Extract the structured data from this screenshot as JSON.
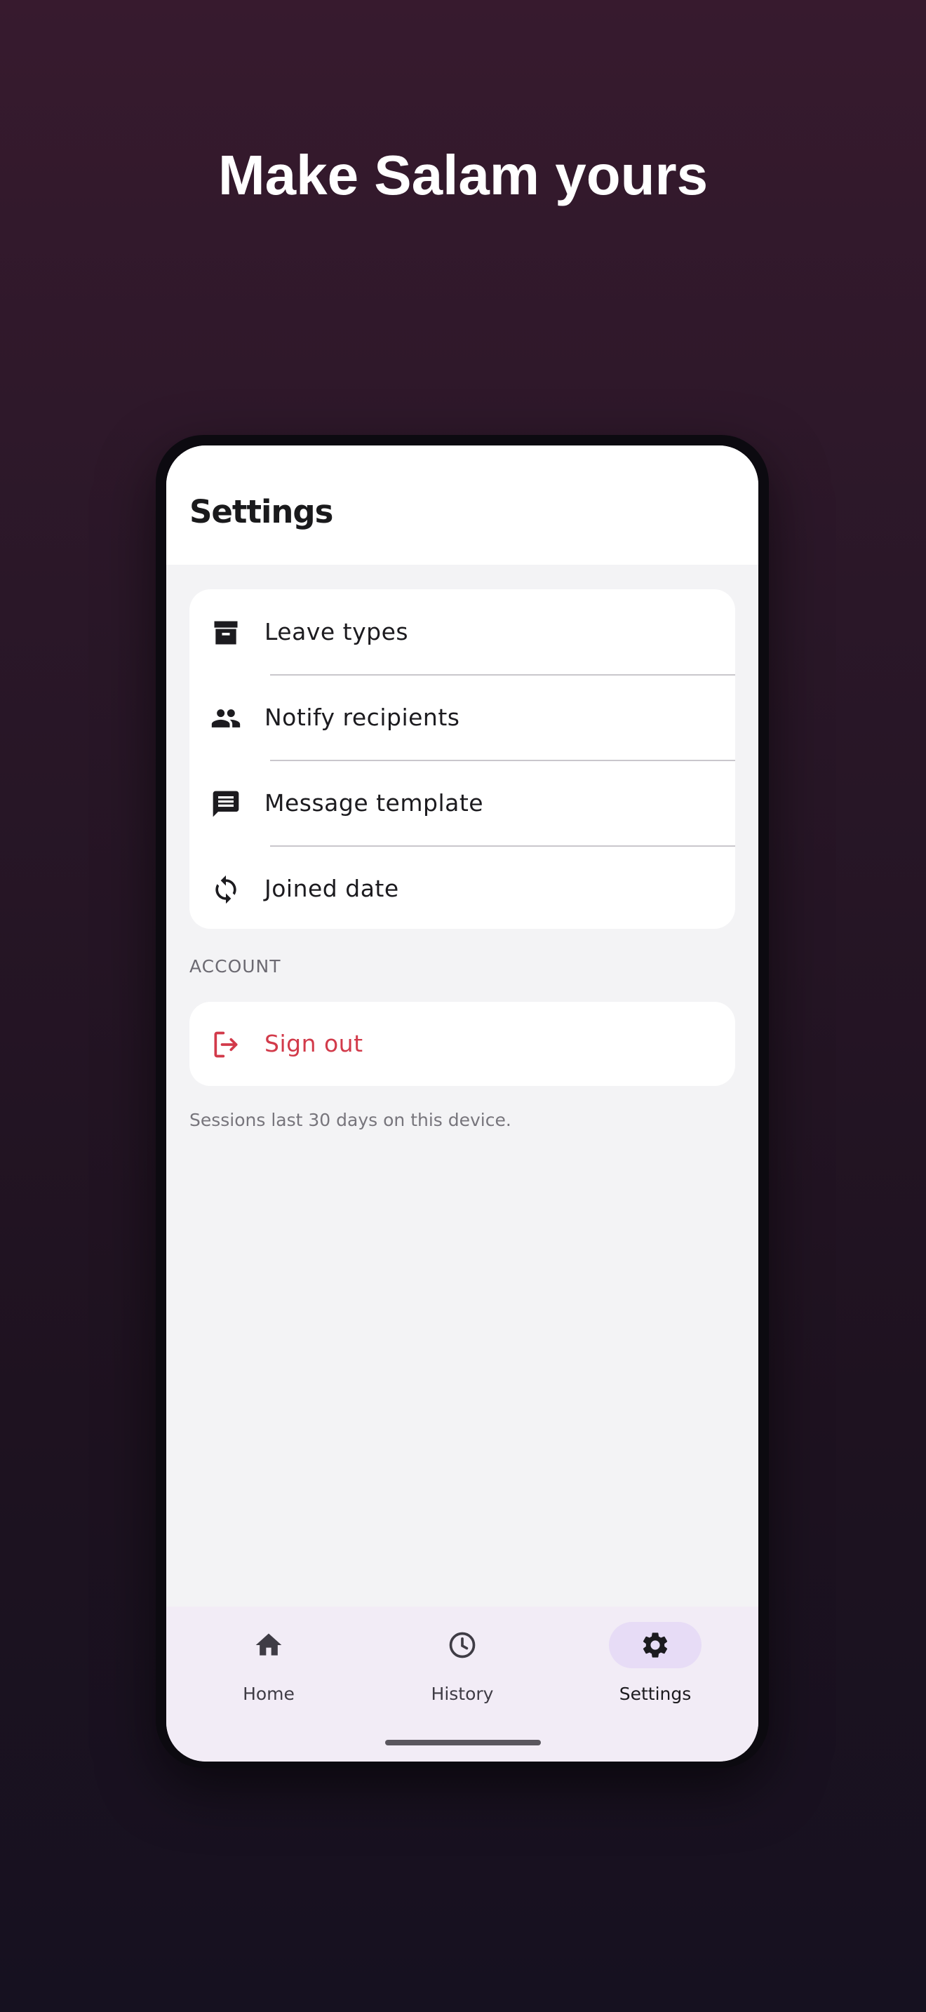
{
  "headline": "Make Salam yours",
  "appbar": {
    "title": "Settings"
  },
  "settings_items": [
    {
      "label": "Leave types",
      "icon": "archive-icon"
    },
    {
      "label": "Notify recipients",
      "icon": "people-icon"
    },
    {
      "label": "Message template",
      "icon": "message-icon"
    },
    {
      "label": "Joined date",
      "icon": "sync-icon"
    }
  ],
  "account": {
    "header": "ACCOUNT",
    "sign_out_label": "Sign out",
    "sign_out_icon": "logout-icon",
    "footnote": "Sessions last 30 days on this device."
  },
  "nav": {
    "items": [
      {
        "label": "Home",
        "icon": "home-icon",
        "active": false
      },
      {
        "label": "History",
        "icon": "clock-icon",
        "active": false
      },
      {
        "label": "Settings",
        "icon": "gear-icon",
        "active": true
      }
    ]
  },
  "colors": {
    "background_top": "#371a2e",
    "background_bottom": "#161120",
    "danger": "#d23a4a",
    "nav_background": "#f2ecf6",
    "nav_active_pill": "#e7dcf6"
  }
}
